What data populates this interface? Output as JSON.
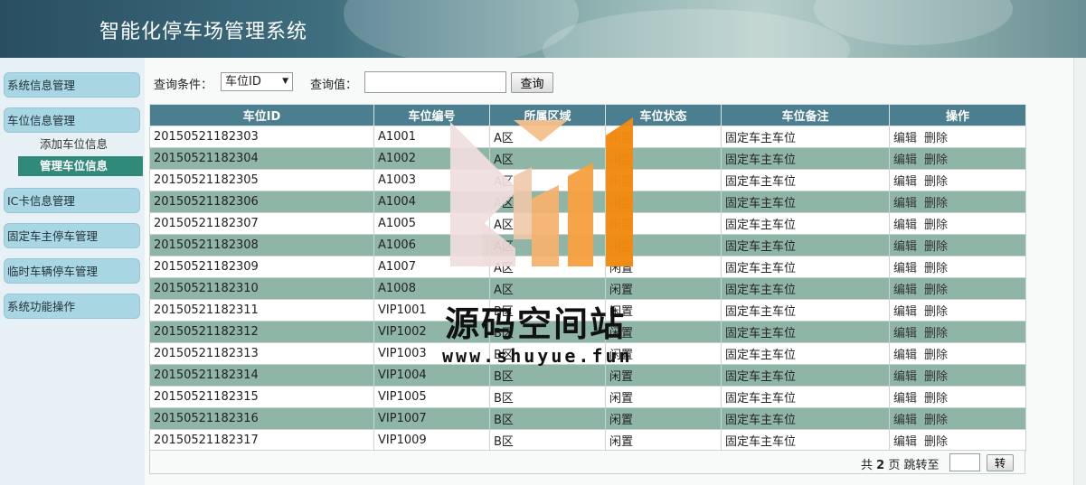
{
  "header": {
    "title": "智能化停车场管理系统"
  },
  "sidebar": {
    "items": [
      {
        "label": "系统信息管理"
      },
      {
        "label": "车位信息管理"
      },
      {
        "label": "IC卡信息管理"
      },
      {
        "label": "固定车主停车管理"
      },
      {
        "label": "临时车辆停车管理"
      },
      {
        "label": "系统功能操作"
      }
    ],
    "subitems": [
      {
        "label": "添加车位信息"
      },
      {
        "label": "管理车位信息"
      }
    ]
  },
  "search": {
    "condition_label": "查询条件：",
    "condition_value": "车位ID",
    "value_label": "查询值：",
    "value": "",
    "button": "查询"
  },
  "table": {
    "headers": [
      "车位ID",
      "车位编号",
      "所属区域",
      "车位状态",
      "车位备注",
      "操作"
    ],
    "rows": [
      [
        "20150521182303",
        "A1001",
        "A区",
        "闲置",
        "固定车主车位"
      ],
      [
        "20150521182304",
        "A1002",
        "A区",
        "闲置",
        "固定车主车位"
      ],
      [
        "20150521182305",
        "A1003",
        "A区",
        "闲置",
        "固定车主车位"
      ],
      [
        "20150521182306",
        "A1004",
        "A区",
        "闲置",
        "固定车主车位"
      ],
      [
        "20150521182307",
        "A1005",
        "A区",
        "闲置",
        "固定车主车位"
      ],
      [
        "20150521182308",
        "A1006",
        "A区",
        "闲置",
        "固定车主车位"
      ],
      [
        "20150521182309",
        "A1007",
        "A区",
        "闲置",
        "固定车主车位"
      ],
      [
        "20150521182310",
        "A1008",
        "A区",
        "闲置",
        "固定车主车位"
      ],
      [
        "20150521182311",
        "VIP1001",
        "B区",
        "闲置",
        "固定车主车位"
      ],
      [
        "20150521182312",
        "VIP1002",
        "B区",
        "闲置",
        "固定车主车位"
      ],
      [
        "20150521182313",
        "VIP1003",
        "B区",
        "闲置",
        "固定车主车位"
      ],
      [
        "20150521182314",
        "VIP1004",
        "B区",
        "闲置",
        "固定车主车位"
      ],
      [
        "20150521182315",
        "VIP1005",
        "B区",
        "闲置",
        "固定车主车位"
      ],
      [
        "20150521182316",
        "VIP1007",
        "B区",
        "闲置",
        "固定车主车位"
      ],
      [
        "20150521182317",
        "VIP1009",
        "B区",
        "闲置",
        "固定车主车位"
      ]
    ],
    "edit_label": "编辑",
    "delete_label": "删除"
  },
  "pager": {
    "prefix": "共",
    "total_pages": "2",
    "suffix": "页 跳转至",
    "go_button": "转"
  },
  "watermark": {
    "text": "源码空间站",
    "url": "www.shuyue.fun"
  },
  "colors": {
    "header_th": "#4b7e8e",
    "row_alt": "#8fb5a7",
    "sidebar_item": "#a9d6e3",
    "sub_active": "#2f8a7a"
  }
}
